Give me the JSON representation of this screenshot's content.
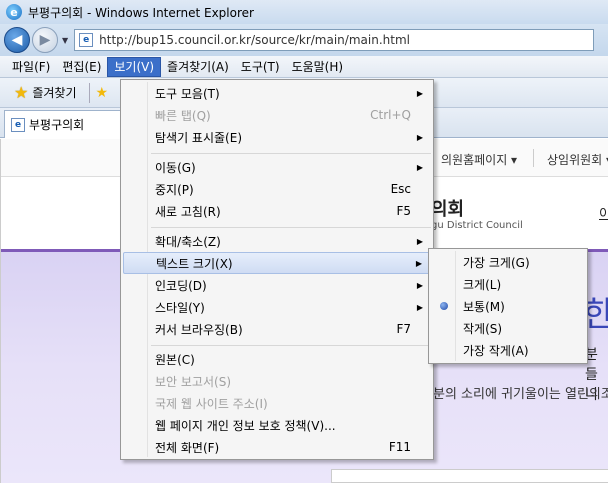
{
  "window": {
    "title": "부평구의회 - Windows Internet Explorer"
  },
  "address": {
    "url": "http://bup15.council.or.kr/source/kr/main/main.html"
  },
  "menubar": [
    {
      "label": "파일(F)"
    },
    {
      "label": "편집(E)"
    },
    {
      "label": "보기(V)"
    },
    {
      "label": "즐겨찾기(A)"
    },
    {
      "label": "도구(T)"
    },
    {
      "label": "도움말(H)"
    }
  ],
  "favorites": {
    "label": "즐겨찾기"
  },
  "tab": {
    "label": "부평구의회"
  },
  "page": {
    "nav_item_1": "의원홈페이지 ▾",
    "nav_item_2": "상임위원회 ▾",
    "logo_ko": "의회",
    "logo_en": "gu District Council",
    "login": "이",
    "headline": "한",
    "subline": "분들니",
    "slogan": "분의 소리에 귀기울이는 열린의조"
  },
  "view_menu": {
    "items": [
      {
        "label": "도구 모음(T)",
        "shortcut": "",
        "submenu": true,
        "disabled": false
      },
      {
        "label": "빠른 탭(Q)",
        "shortcut": "Ctrl+Q",
        "submenu": false,
        "disabled": true
      },
      {
        "label": "탐색기 표시줄(E)",
        "shortcut": "",
        "submenu": true,
        "disabled": false
      },
      {
        "label": "이동(G)",
        "shortcut": "",
        "submenu": true,
        "disabled": false
      },
      {
        "label": "중지(P)",
        "shortcut": "Esc",
        "submenu": false,
        "disabled": false
      },
      {
        "label": "새로 고침(R)",
        "shortcut": "F5",
        "submenu": false,
        "disabled": false
      },
      {
        "label": "확대/축소(Z)",
        "shortcut": "",
        "submenu": true,
        "disabled": false
      },
      {
        "label": "텍스트 크기(X)",
        "shortcut": "",
        "submenu": true,
        "disabled": false
      },
      {
        "label": "인코딩(D)",
        "shortcut": "",
        "submenu": true,
        "disabled": false
      },
      {
        "label": "스타일(Y)",
        "shortcut": "",
        "submenu": true,
        "disabled": false
      },
      {
        "label": "커서 브라우징(B)",
        "shortcut": "F7",
        "submenu": false,
        "disabled": false
      },
      {
        "label": "원본(C)",
        "shortcut": "",
        "submenu": false,
        "disabled": false
      },
      {
        "label": "보안 보고서(S)",
        "shortcut": "",
        "submenu": false,
        "disabled": true
      },
      {
        "label": "국제 웹 사이트 주소(I)",
        "shortcut": "",
        "submenu": false,
        "disabled": true
      },
      {
        "label": "웹 페이지 개인 정보 보호 정책(V)...",
        "shortcut": "",
        "submenu": false,
        "disabled": false
      },
      {
        "label": "전체 화면(F)",
        "shortcut": "F11",
        "submenu": false,
        "disabled": false
      }
    ]
  },
  "text_size_menu": {
    "items": [
      {
        "label": "가장 크게(G)",
        "selected": false
      },
      {
        "label": "크게(L)",
        "selected": false
      },
      {
        "label": "보통(M)",
        "selected": true
      },
      {
        "label": "작게(S)",
        "selected": false
      },
      {
        "label": "가장 작게(A)",
        "selected": false
      }
    ]
  },
  "icons": {
    "back": "back-arrow-icon",
    "forward": "forward-arrow-icon",
    "favorites": "star-icon",
    "selected_size": "radio-dot-icon"
  }
}
